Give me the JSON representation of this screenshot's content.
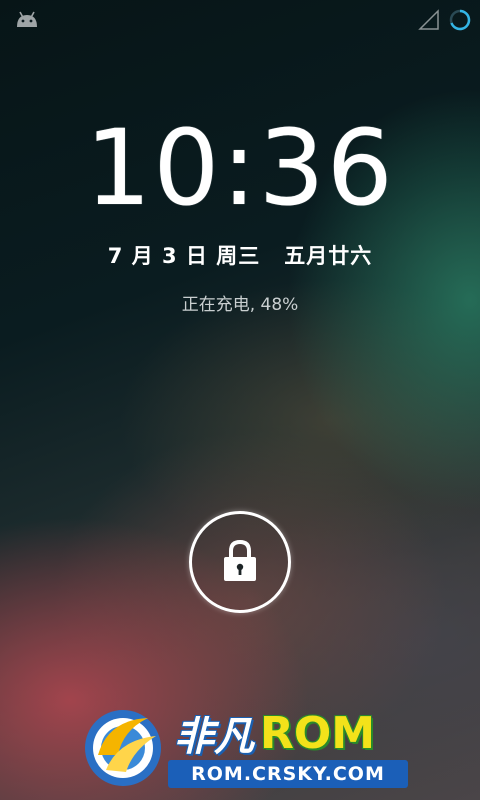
{
  "statusbar": {
    "notification_icon": "android-debug-icon",
    "signal_icon": "signal-empty-icon",
    "battery_icon": "battery-charging-circle-icon",
    "battery_color": "#33b5e5"
  },
  "lockscreen": {
    "time": "10:36",
    "date_left": "7 月 3 日 周三",
    "date_lunar": "五月廿六",
    "charging_status": "正在充电, 48%",
    "unlock_icon": "lock-icon"
  },
  "watermark": {
    "title_cn": "非凡",
    "title_rom": "ROM",
    "url": "ROM.CRSKY.COM"
  }
}
